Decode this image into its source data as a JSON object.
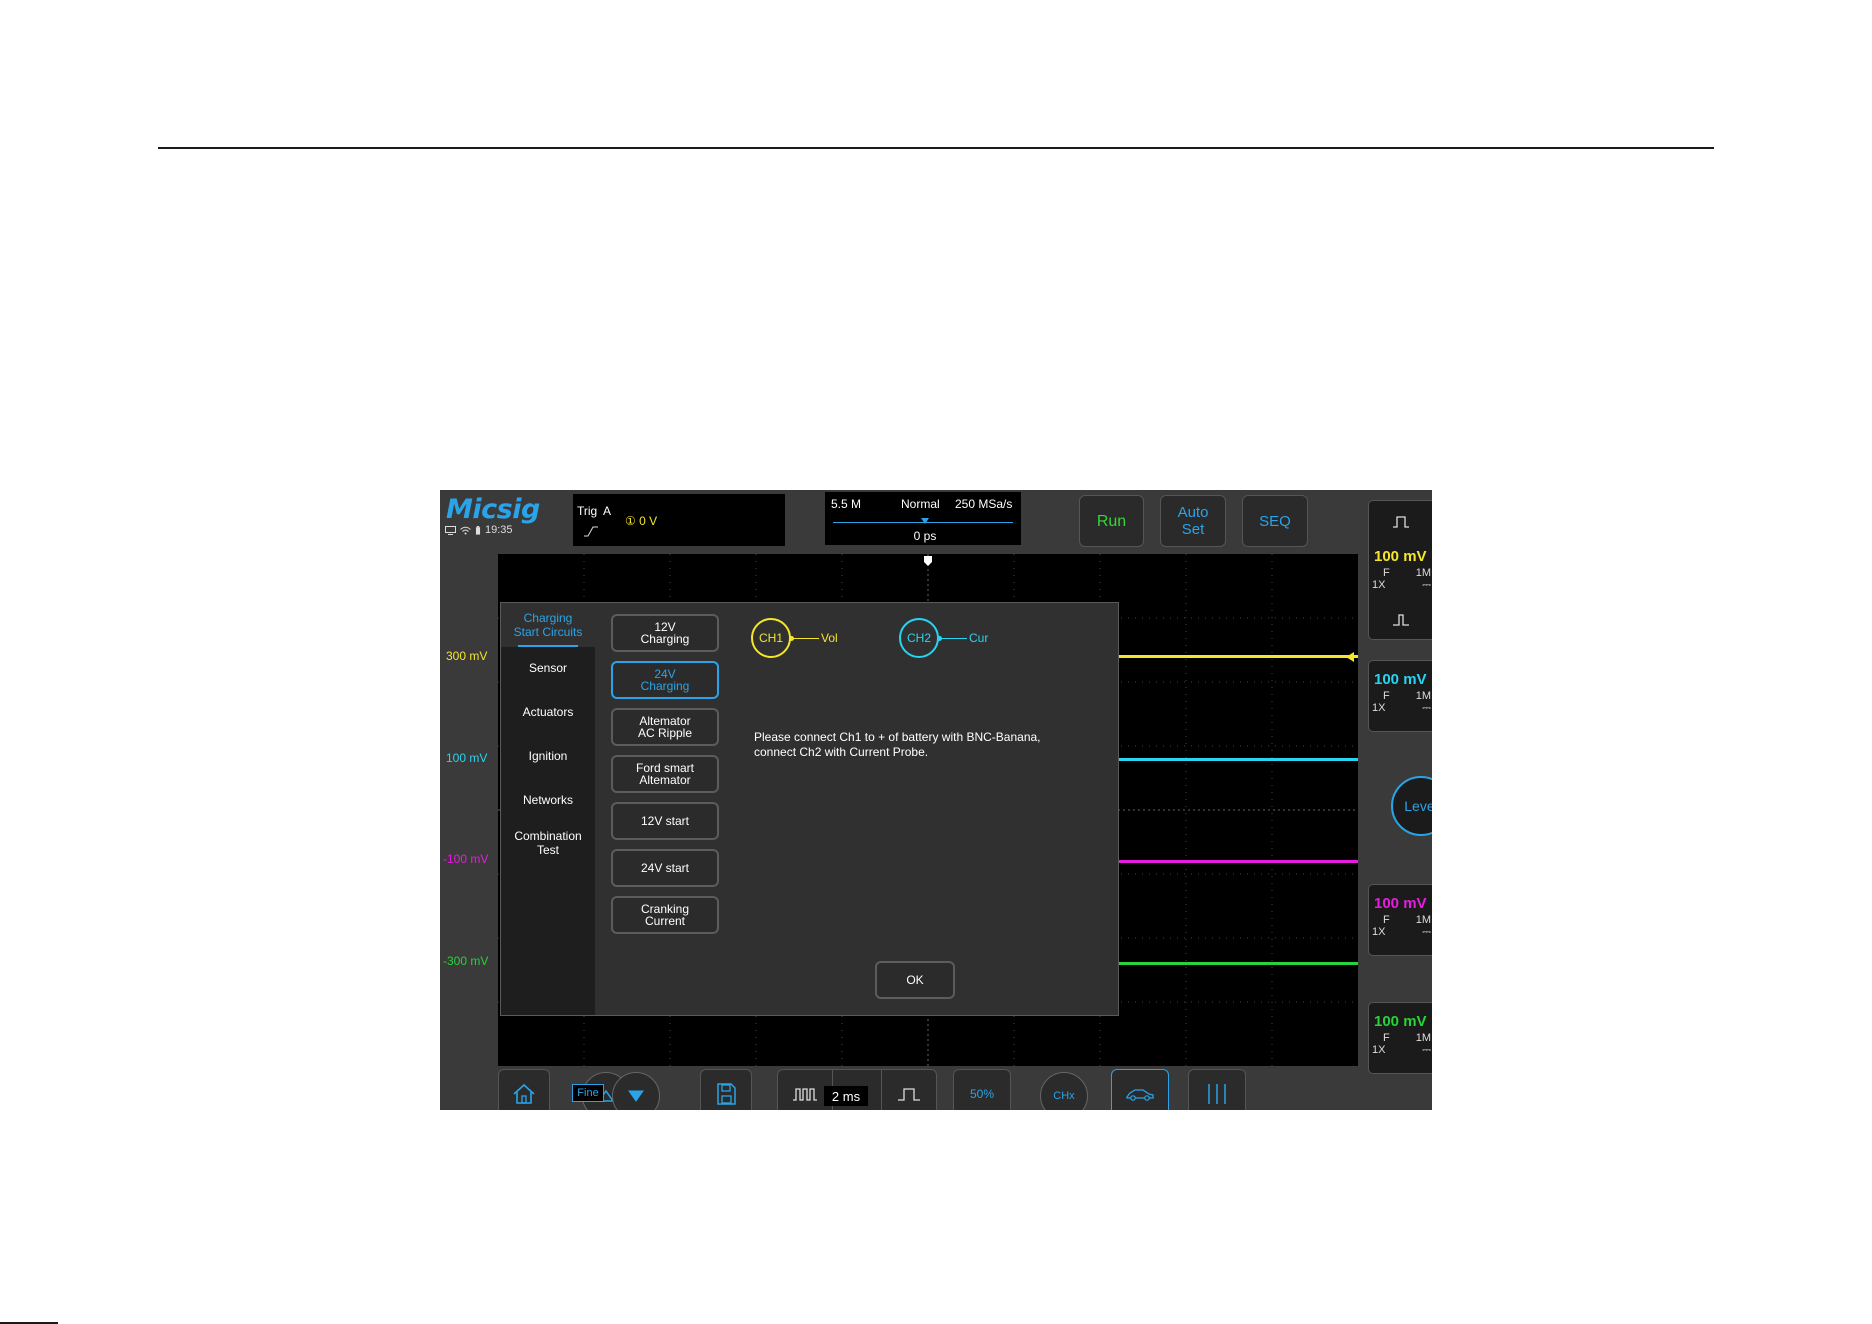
{
  "header": {
    "logo_text": "Micsig",
    "time": "19:35"
  },
  "trigger": {
    "label": "Trig",
    "channel": "A",
    "level": "① 0  V"
  },
  "timebase": {
    "memory": "5.5 M",
    "mode": "Normal",
    "sample_rate": "250 MSa/s",
    "position": "0 ps"
  },
  "toolbar": {
    "run_label": "Run",
    "auto_set_label": "Auto\nSet",
    "seq_label": "SEQ"
  },
  "scale_labels": {
    "ch1": "300 mV",
    "ch2": "100 mV",
    "ch3": "-100 mV",
    "ch4": "-300 mV"
  },
  "channels": [
    {
      "volt": "100 mV",
      "coupling": "F",
      "impedance": "1M",
      "probe": "1X",
      "dc": "⎓",
      "color": "#f5e62c"
    },
    {
      "volt": "100 mV",
      "coupling": "F",
      "impedance": "1M",
      "probe": "1X",
      "dc": "⎓",
      "color": "#27d4f2"
    },
    {
      "volt": "100 mV",
      "coupling": "F",
      "impedance": "1M",
      "probe": "1X",
      "dc": "⎓",
      "color": "#e81ce0"
    },
    {
      "volt": "100 mV",
      "coupling": "F",
      "impedance": "1M",
      "probe": "1X",
      "dc": "⎓",
      "color": "#25d438"
    }
  ],
  "level_label": "Level",
  "dialog": {
    "menu_active": "Charging\nStart Circuits",
    "menu_items": [
      "Sensor",
      "Actuators",
      "Ignition",
      "Networks",
      "Combination\nTest"
    ],
    "sub_buttons": [
      "12V\nCharging",
      "24V\nCharging",
      "Altemator\nAC Ripple",
      "Ford smart\nAltemator",
      "12V start",
      "24V start",
      "Cranking\nCurrent"
    ],
    "active_sub_index": 1,
    "ch1_label": "CH1",
    "ch1_conn": "Vol",
    "ch2_label": "CH2",
    "ch2_conn": "Cur",
    "instruction_line1": "Please connect Ch1 to + of battery with BNC-Banana,",
    "instruction_line2": "connect Ch2 with Current Probe.",
    "ok_label": "OK"
  },
  "bottom_bar": {
    "fine_label": "Fine",
    "timebase_value": "2 ms",
    "fifty_label": "50%",
    "chx_label": "CHx"
  },
  "colors": {
    "accent": "#2ba3e8",
    "ch1": "#f5e62c",
    "ch2": "#27d4f2",
    "ch3": "#e81ce0",
    "ch4": "#25d438",
    "run": "#35d635"
  }
}
